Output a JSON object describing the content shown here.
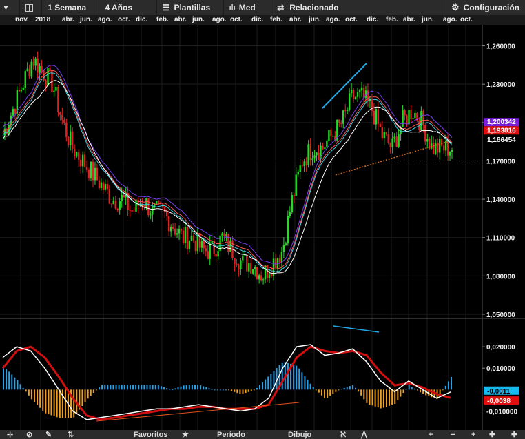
{
  "toolbar": {
    "interval": "1 Semana",
    "range": "4 Años",
    "templates": "Plantillas",
    "studies": "Med",
    "related": "Relacionado",
    "settings": "Configuración"
  },
  "time_axis": [
    "nov.",
    "2018",
    "abr.",
    "jun.",
    "ago.",
    "oct.",
    "dic.",
    "feb.",
    "abr.",
    "jun.",
    "ago.",
    "oct.",
    "dic.",
    "feb.",
    "abr.",
    "jun.",
    "ago.",
    "oct.",
    "dic.",
    "feb.",
    "abr.",
    "jun.",
    "ago.",
    "oct."
  ],
  "bottom": {
    "favorites": "Favoritos",
    "period": "Período",
    "drawing": "Dibujo"
  },
  "colors": {
    "up": "#22dd22",
    "down": "#dd2222",
    "ma_purple": "#7b3ff2",
    "ma_red": "#ff5555",
    "ma_cyan": "#40d0e0",
    "ma_white": "#ffffff",
    "badge_purple": "#7a1fd8",
    "badge_red": "#e01010",
    "badge_cyan": "#18b8f0"
  },
  "chart_data": [
    {
      "type": "candlestick",
      "title": "",
      "ylim": [
        1.05,
        1.27
      ],
      "y_ticks": [
        "1,260000",
        "1,230000",
        "1,200000",
        "1,170000",
        "1,140000",
        "1,110000",
        "1,080000",
        "1,050000"
      ],
      "y_tick_values": [
        1.26,
        1.23,
        1.2,
        1.17,
        1.14,
        1.11,
        1.08,
        1.05
      ],
      "weekly_close": [
        1.19,
        1.21,
        1.23,
        1.25,
        1.24,
        1.23,
        1.2,
        1.18,
        1.17,
        1.16,
        1.15,
        1.14,
        1.14,
        1.13,
        1.14,
        1.13,
        1.13,
        1.12,
        1.11,
        1.11,
        1.1,
        1.1,
        1.11,
        1.1,
        1.09,
        1.09,
        1.08,
        1.09,
        1.1,
        1.14,
        1.17,
        1.18,
        1.18,
        1.19,
        1.2,
        1.22,
        1.22,
        1.21,
        1.19,
        1.18,
        1.2,
        1.21,
        1.2,
        1.18,
        1.18,
        1.18
      ],
      "price_labels": [
        {
          "text": "1,200342",
          "value": 1.20034,
          "color": "#7a1fd8"
        },
        {
          "text": "1,193816",
          "value": 1.19382,
          "color": "#e01010"
        },
        {
          "text": "1,186454",
          "value": 1.18645,
          "color": "#ffffff"
        }
      ],
      "support_level": 1.17,
      "moving_averages": [
        "purple",
        "red",
        "cyan",
        "white"
      ]
    },
    {
      "type": "macd",
      "ylim": [
        -0.015,
        0.03
      ],
      "y_ticks": [
        "0,020000",
        "0,010000",
        "-0,010000"
      ],
      "y_tick_values": [
        0.02,
        0.01,
        -0.01
      ],
      "macd_label": "-0,0011",
      "signal_label": "-0,0038",
      "macd": [
        0.015,
        0.02,
        0.018,
        0.01,
        0.0,
        -0.01,
        -0.014,
        -0.013,
        -0.012,
        -0.011,
        -0.01,
        -0.009,
        -0.009,
        -0.008,
        -0.007,
        -0.008,
        -0.009,
        -0.01,
        -0.009,
        -0.004,
        0.01,
        0.02,
        0.021,
        0.016,
        0.017,
        0.019,
        0.013,
        0.004,
        -0.001,
        0.004,
        0.0,
        -0.004,
        -0.0011
      ],
      "signal": [
        0.01,
        0.018,
        0.02,
        0.015,
        0.006,
        -0.004,
        -0.012,
        -0.014,
        -0.013,
        -0.012,
        -0.011,
        -0.01,
        -0.009,
        -0.009,
        -0.008,
        -0.008,
        -0.009,
        -0.009,
        -0.009,
        -0.007,
        0.004,
        0.015,
        0.02,
        0.018,
        0.017,
        0.018,
        0.016,
        0.008,
        0.002,
        0.003,
        0.001,
        -0.002,
        -0.0038
      ]
    }
  ]
}
